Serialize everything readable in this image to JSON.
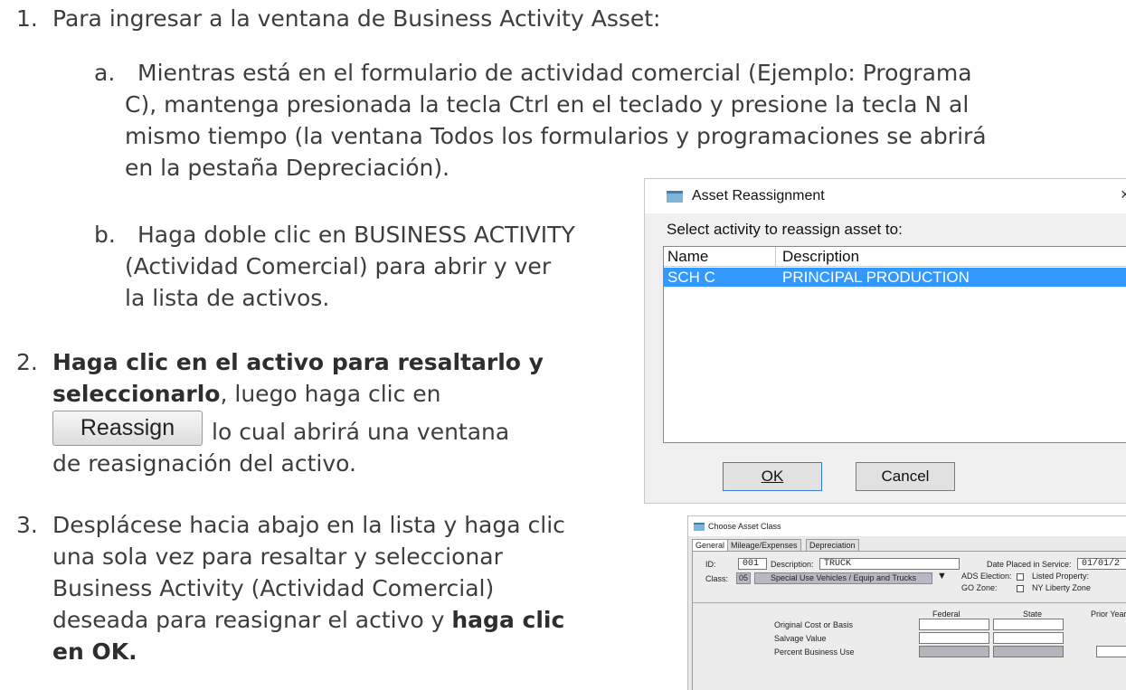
{
  "steps": {
    "s1_num": "1.",
    "s1_text": "Para ingresar a la ventana de Business Activity Asset:",
    "s1a_letter": "a.",
    "s1a_line1": "Mientras está en el formulario de actividad comercial (Ejemplo: Programa",
    "s1a_line2": "C), mantenga presionada la tecla Ctrl en el teclado y presione la tecla N al",
    "s1a_line3": "mismo tiempo (la ventana Todos los formularios y programaciones se abrirá",
    "s1a_line4": "en la pestaña Depreciación).",
    "s1b_letter": "b.",
    "s1b_line1": "Haga doble clic en BUSINESS ACTIVITY",
    "s1b_line2": "(Actividad Comercial) para abrir y ver",
    "s1b_line3": "la lista de activos.",
    "s2_num": "2.",
    "s2_bold1": "Haga clic en el activo para resaltarlo y",
    "s2_bold2": "seleccionarlo",
    "s2_rest2": ", luego haga clic en",
    "s2_after_btn": "lo cual abrirá una ventana",
    "s2_line4": "de reasignación del activo.",
    "s3_num": "3.",
    "s3_line1": "Desplácese hacia abajo en la lista y haga clic",
    "s3_line2": "una sola vez para resaltar y seleccionar",
    "s3_line3": "Business Activity (Actividad Comercial)",
    "s3_line4a": "deseada para reasignar el activo y ",
    "s3_line4b": "haga clic",
    "s3_line5": "en OK."
  },
  "reassign_button": {
    "label": "Reassign"
  },
  "asset_reassignment_dialog": {
    "title": "Asset Reassignment",
    "close_glyph": "×",
    "prompt": "Select activity to reassign asset to:",
    "columns": [
      "Name",
      "Description"
    ],
    "rows": [
      {
        "name": "SCH C",
        "description": "PRINCIPAL PRODUCTION"
      }
    ],
    "ok_label": "OK",
    "cancel_label": "Cancel"
  },
  "choose_asset_class": {
    "title": "Choose Asset Class",
    "tabs": [
      "General",
      "Mileage/Expenses",
      "Depreciation"
    ],
    "id_label": "ID:",
    "id_value": "001",
    "description_label": "Description:",
    "description_value": "TRUCK",
    "date_label": "Date Placed in Service:",
    "date_value": "01/01/2",
    "class_label": "Class:",
    "class_value": "05",
    "class_desc": "Special Use Vehicles / Equip and Trucks",
    "ads_label": "ADS Election:",
    "listed_label": "Listed Property:",
    "gozone_label": "GO Zone:",
    "nyliberty_label": "NY Liberty Zone",
    "col_federal": "Federal",
    "col_state": "State",
    "col_prior": "Prior Year",
    "row1": "Original Cost or Basis",
    "row2": "Salvage Value",
    "row3": "Percent Business Use"
  }
}
